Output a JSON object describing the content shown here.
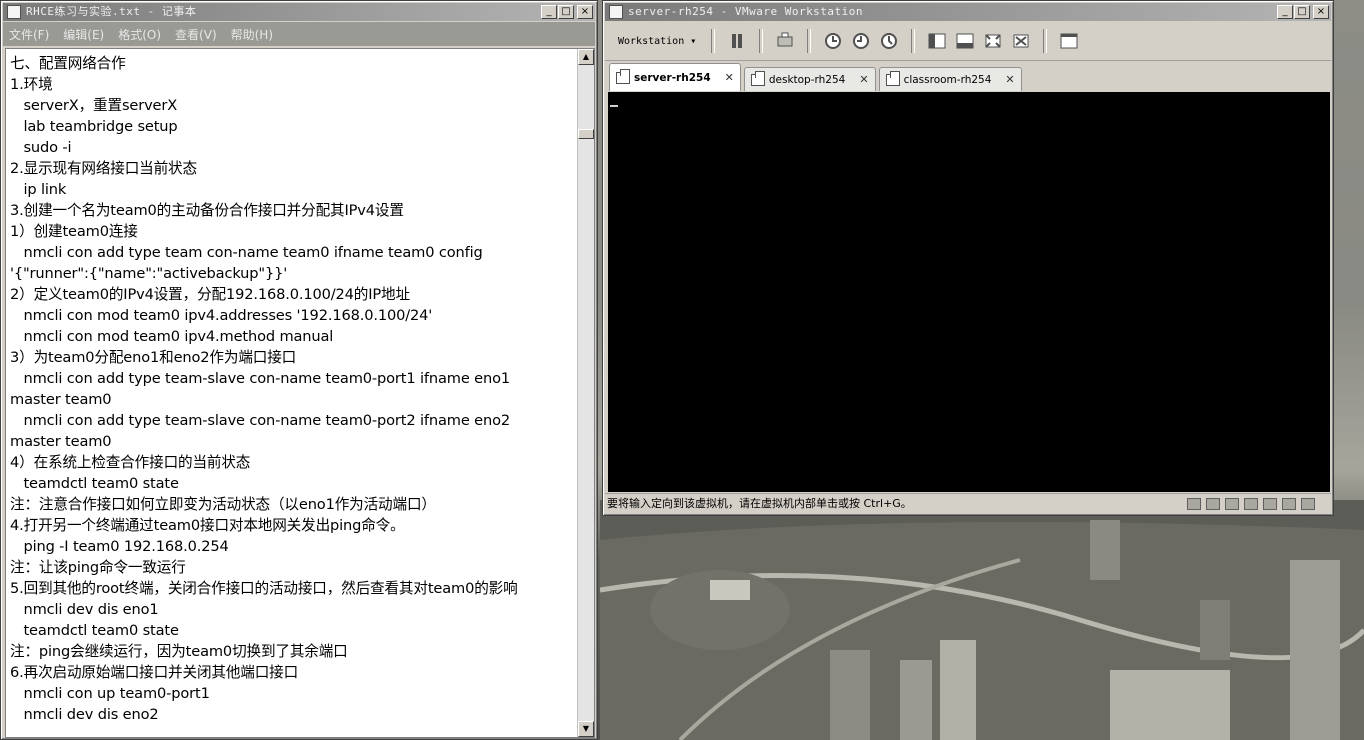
{
  "notepad": {
    "title": "RHCE练习与实验.txt - 记事本",
    "menu": [
      "文件(F)",
      "编辑(E)",
      "格式(O)",
      "查看(V)",
      "帮助(H)"
    ],
    "lines": [
      "七、配置网络合作",
      "1.环境",
      "   serverX，重置serverX",
      "   lab teambridge setup",
      "   sudo -i",
      "2.显示现有网络接口当前状态",
      "   ip link",
      "3.创建一个名为team0的主动备份合作接口并分配其IPv4设置",
      "1）创建team0连接",
      "   nmcli con add type team con-name team0 ifname team0 config",
      "'{\"runner\":{\"name\":\"activebackup\"}}'",
      "2）定义team0的IPv4设置，分配192.168.0.100/24的IP地址",
      "   nmcli con mod team0 ipv4.addresses '192.168.0.100/24'",
      "   nmcli con mod team0 ipv4.method manual",
      "3）为team0分配eno1和eno2作为端口接口",
      "   nmcli con add type team-slave con-name team0-port1 ifname eno1",
      "master team0",
      "   nmcli con add type team-slave con-name team0-port2 ifname eno2",
      "master team0",
      "4）在系统上检查合作接口的当前状态",
      "   teamdctl team0 state",
      "注：注意合作接口如何立即变为活动状态（以eno1作为活动端口）",
      "4.打开另一个终端通过team0接口对本地网关发出ping命令。",
      "   ping -I team0 192.168.0.254",
      "注：让该ping命令一致运行",
      "5.回到其他的root终端，关闭合作接口的活动接口，然后查看其对team0的影响",
      "   nmcli dev dis eno1",
      "   teamdctl team0 state",
      "注：ping会继续运行，因为team0切换到了其余端口",
      "6.再次启动原始端口接口并关闭其他端口接口",
      "   nmcli con up team0-port1",
      "   nmcli dev dis eno2"
    ]
  },
  "vmware": {
    "title": "server-rh254 - VMware Workstation",
    "workstation_menu": "Workstation ▾",
    "tabs": [
      {
        "label": "server-rh254",
        "active": true
      },
      {
        "label": "desktop-rh254",
        "active": false
      },
      {
        "label": "classroom-rh254",
        "active": false
      }
    ],
    "status_hint": "要将输入定向到该虚拟机，请在虚拟机内部单击或按 Ctrl+G。",
    "screen_color": "#000000"
  },
  "caption_buttons": {
    "minimize": "_",
    "maximize": "□",
    "close": "×"
  }
}
